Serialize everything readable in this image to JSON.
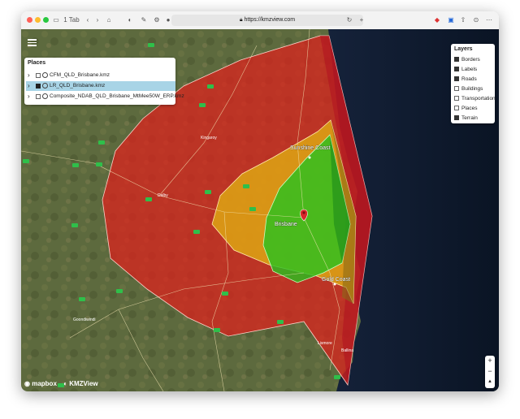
{
  "browser": {
    "tab_label": "1 Tab",
    "url": "https://kmzview.com"
  },
  "places_panel": {
    "title": "Places",
    "items": [
      {
        "name": "CFM_QLD_Brisbane.kmz",
        "checked": false,
        "selected": false
      },
      {
        "name": "LR_QLD_Brisbane.kmz",
        "checked": true,
        "selected": true
      },
      {
        "name": "Composite_NDAB_QLD_Brisbane_MtMee50W_ERP.kmz",
        "checked": false,
        "selected": false
      }
    ]
  },
  "layers_panel": {
    "title": "Layers",
    "items": [
      {
        "name": "Borders",
        "checked": true
      },
      {
        "name": "Labels",
        "checked": true
      },
      {
        "name": "Roads",
        "checked": true
      },
      {
        "name": "Buildings",
        "checked": false
      },
      {
        "name": "Transportation",
        "checked": false
      },
      {
        "name": "Places",
        "checked": false
      },
      {
        "name": "Terrain",
        "checked": true
      }
    ]
  },
  "map": {
    "cities": [
      "Sunshine Coast",
      "Brisbane",
      "Gold Coast",
      "Kingaroy",
      "Dalby",
      "Goondiwindi",
      "Lismore",
      "Ballina"
    ],
    "coverage_colors": {
      "outer": "#e0201c",
      "middle": "#e0b012",
      "inner": "#27c21f"
    },
    "zoom_in": "+",
    "zoom_out": "−",
    "compass": "▲",
    "attribution_mapbox": "mapbox",
    "attribution_kmz": "KMZView"
  }
}
